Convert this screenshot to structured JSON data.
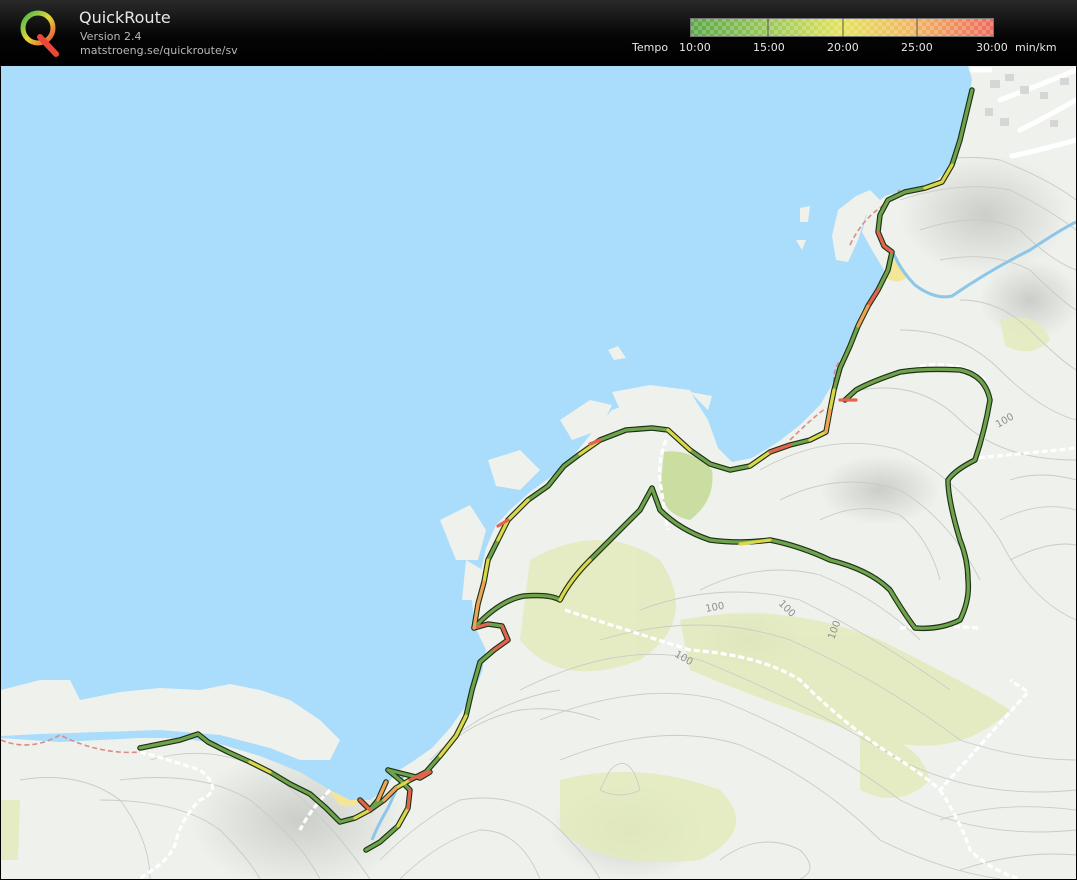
{
  "app": {
    "name": "QuickRoute",
    "version": "Version 2.4",
    "url": "matstroeng.se/quickroute/sv"
  },
  "legend": {
    "title": "Tempo",
    "ticks": [
      "10:00",
      "15:00",
      "20:00",
      "25:00",
      "30:00"
    ],
    "unit": "min/km",
    "colors": {
      "fast": "#4f9a3a",
      "mid": "#d8d84a",
      "slow": "#e8594a"
    }
  },
  "map": {
    "contour_labels": [
      "100",
      "100",
      "100",
      "100",
      "100"
    ],
    "colors": {
      "water": "#aadcfb",
      "land": "#eef1ec",
      "vegetation": "#e2ebb8",
      "contour": "#c9ccc6",
      "path_dashed": "#ffffff"
    }
  }
}
